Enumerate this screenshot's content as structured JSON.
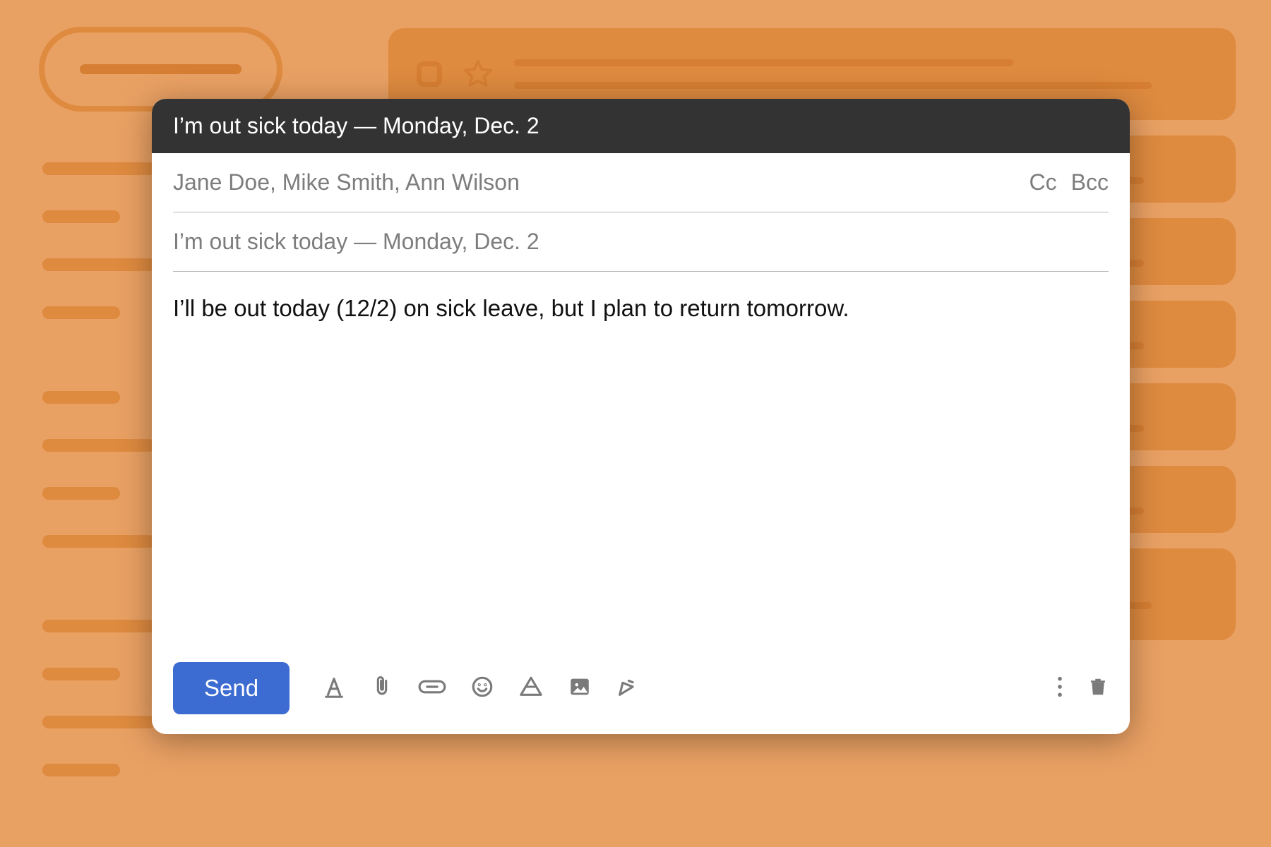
{
  "compose": {
    "window_title": "I’m out sick today — Monday, Dec. 2",
    "recipients": "Jane Doe, Mike Smith, Ann Wilson",
    "cc_label": "Cc",
    "bcc_label": "Bcc",
    "subject": "I’m out sick today — Monday, Dec. 2",
    "body": "I’ll be out today (12/2) on sick leave, but I plan to return tomorrow.",
    "send_label": "Send"
  }
}
